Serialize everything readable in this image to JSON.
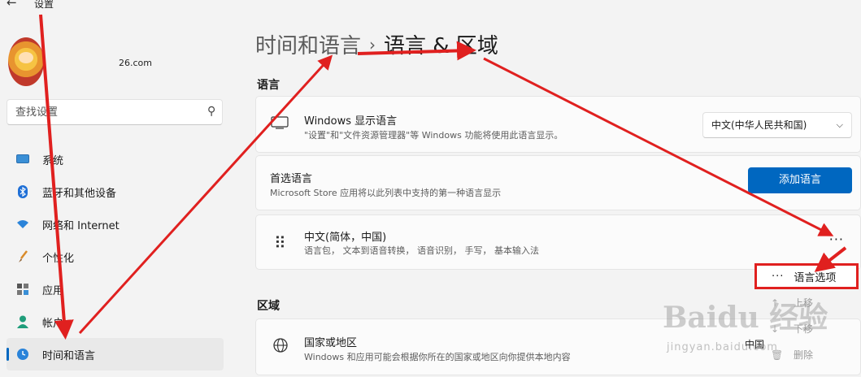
{
  "titlebar": {
    "back_icon": "←",
    "title": "设置"
  },
  "sidebar": {
    "user_email": "26.com",
    "search_placeholder": "查找设置",
    "items": [
      {
        "label": "系统",
        "icon": "system-icon"
      },
      {
        "label": "蓝牙和其他设备",
        "icon": "bluetooth-icon"
      },
      {
        "label": "网络和 Internet",
        "icon": "wifi-icon"
      },
      {
        "label": "个性化",
        "icon": "brush-icon"
      },
      {
        "label": "应用",
        "icon": "apps-icon"
      },
      {
        "label": "帐户",
        "icon": "person-icon"
      },
      {
        "label": "时间和语言",
        "icon": "clock-icon",
        "active": true
      }
    ]
  },
  "breadcrumb": {
    "parent": "时间和语言",
    "separator": "›",
    "current": "语言 & 区域"
  },
  "language_section": {
    "title": "语言",
    "display_language": {
      "title": "Windows 显示语言",
      "desc": "\"设置\"和\"文件资源管理器\"等 Windows 功能将使用此语言显示。",
      "selected": "中文(中华人民共和国)",
      "chevron": "⌵"
    },
    "preferred": {
      "title": "首选语言",
      "desc": "Microsoft Store 应用将以此列表中支持的第一种语言显示",
      "button": "添加语言"
    },
    "language_item": {
      "handle": "⠿",
      "title": "中文(简体，中国)",
      "desc": "语言包， 文本到语音转换， 语音识别， 手写， 基本输入法",
      "more": "···"
    }
  },
  "context_menu": {
    "options": "语言选项",
    "dots": "···",
    "move_up": "上移",
    "move_down": "下移",
    "remove": "删除"
  },
  "region_section": {
    "title": "区域",
    "country": {
      "title": "国家或地区",
      "desc": "Windows 和应用可能会根据你所在的国家或地区向你提供本地内容",
      "value": "中国"
    }
  },
  "watermark": {
    "main": "Baidu 经验",
    "sub": "jingyan.baidu.com"
  },
  "colors": {
    "accent": "#0067c0",
    "annotation": "#e0201f"
  }
}
